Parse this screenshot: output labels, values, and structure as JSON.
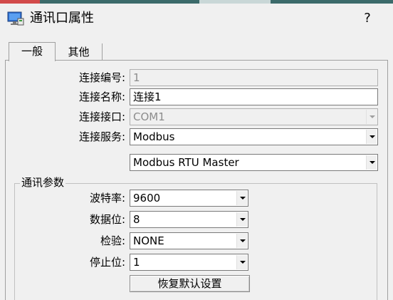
{
  "window": {
    "title": "通讯口属性",
    "help_label": "?"
  },
  "tabs": [
    {
      "label": "一般",
      "active": true
    },
    {
      "label": "其他",
      "active": false
    }
  ],
  "connection": {
    "number_label": "连接编号:",
    "number_value": "1",
    "name_label": "连接名称:",
    "name_value": "连接1",
    "port_label": "连接接口:",
    "port_value": "COM1",
    "service_label": "连接服务:",
    "service_value": "Modbus",
    "protocol_value": "Modbus RTU Master"
  },
  "comm_params": {
    "group_title": "通讯参数",
    "baud_label": "波特率:",
    "baud_value": "9600",
    "databits_label": "数据位:",
    "databits_value": "8",
    "parity_label": "检验:",
    "parity_value": "NONE",
    "stopbits_label": "停止位:",
    "stopbits_value": "1",
    "reset_button": "恢复默认设置"
  },
  "icons": {
    "app": "monitor-network-icon"
  },
  "colors": {
    "background": "#f0f0f0",
    "disabled_text": "#8c8c8c"
  }
}
